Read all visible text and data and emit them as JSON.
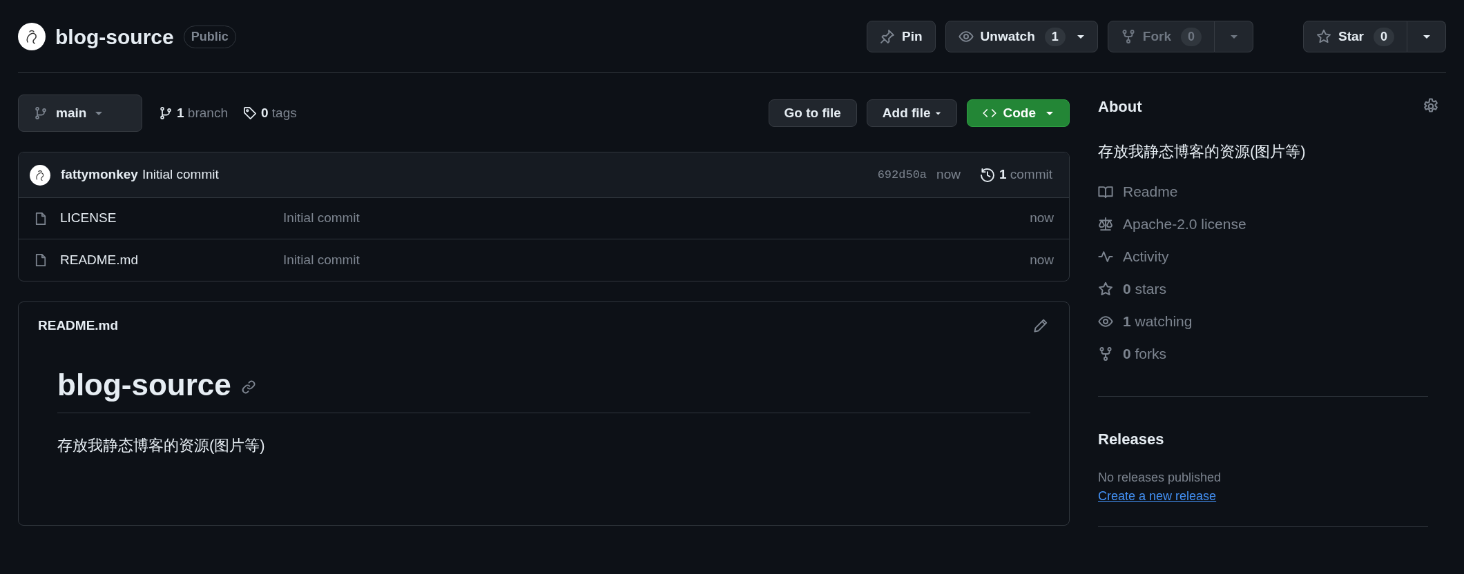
{
  "repo": {
    "name": "blog-source",
    "visibility": "Public"
  },
  "actions": [
    {
      "kind": "pin",
      "label": "Pin",
      "disabled": false
    },
    {
      "kind": "watch",
      "label": "Unwatch",
      "count": "1",
      "disabled": false
    },
    {
      "kind": "fork",
      "label": "Fork",
      "count": "0",
      "disabled": true
    },
    {
      "kind": "star",
      "label": "Star",
      "count": "0",
      "disabled": false
    }
  ],
  "branch_bar": {
    "branch": "main",
    "branches": "**1** branch",
    "tags": "**0** tags",
    "buttons": [
      {
        "kind": "plain",
        "label": "Go to file"
      },
      {
        "kind": "menu",
        "label": "Add file"
      },
      {
        "kind": "primary",
        "label": "Code"
      }
    ]
  },
  "latest_commit": {
    "author": "fattymonkey",
    "message": "Initial commit",
    "sha": "692d50a",
    "time": "now",
    "commits": "**1** commit"
  },
  "files": [
    {
      "name": "LICENSE",
      "message": "Initial commit",
      "time": "now"
    },
    {
      "name": "README.md",
      "message": "Initial commit",
      "time": "now"
    }
  ],
  "readme": {
    "filename": "README.md",
    "heading": "blog-source",
    "body": "存放我静态博客的资源(图片等)"
  },
  "about": {
    "title": "About",
    "description": "存放我静态博客的资源(图片等)",
    "links": [
      {
        "kind": "readme",
        "label": "Readme"
      },
      {
        "kind": "license",
        "label": "Apache-2.0 license"
      },
      {
        "kind": "activity",
        "label": "Activity"
      },
      {
        "kind": "stars",
        "label": "**0** stars"
      },
      {
        "kind": "watching",
        "label": "**1** watching"
      },
      {
        "kind": "forks",
        "label": "**0** forks"
      }
    ]
  },
  "releases": {
    "title": "Releases",
    "empty_text": "No releases published",
    "link": "Create a new release"
  }
}
